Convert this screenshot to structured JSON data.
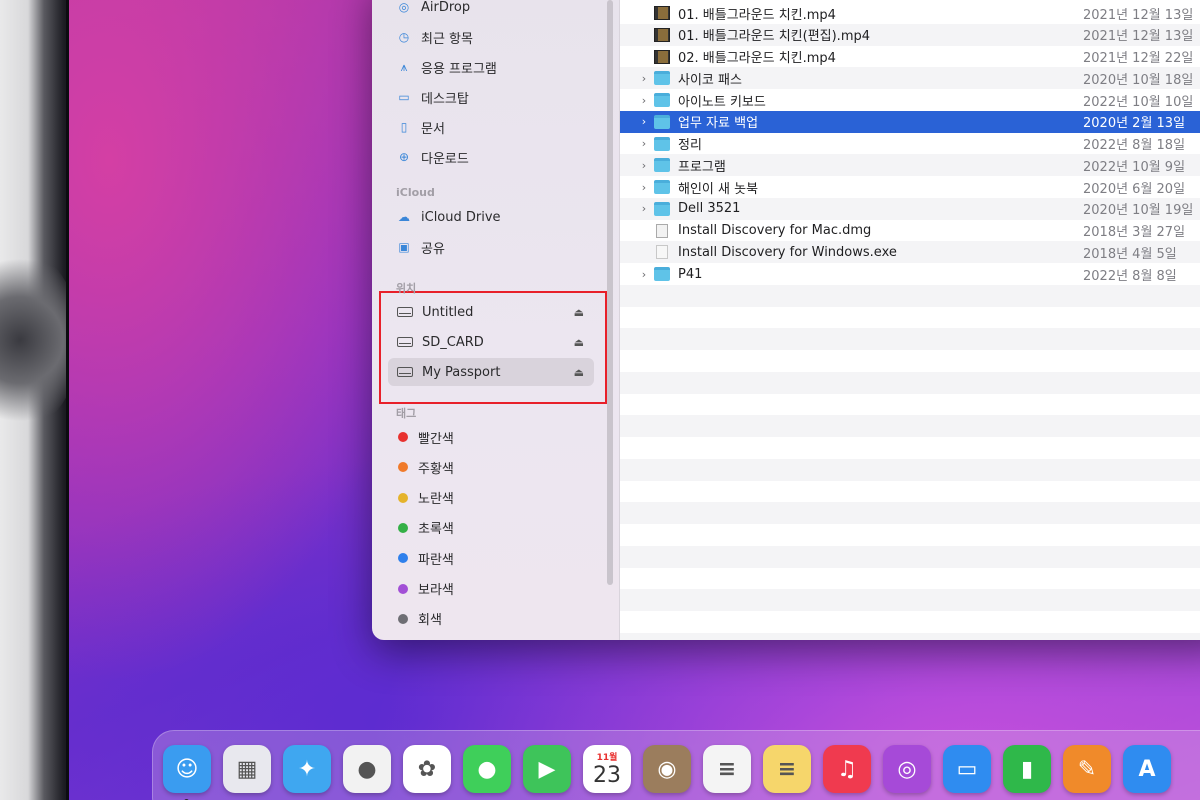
{
  "sidebar": {
    "favorites": [
      {
        "label": "AirDrop",
        "icon": "airdrop-icon"
      },
      {
        "label": "최근 항목",
        "icon": "clock-icon"
      },
      {
        "label": "응용 프로그램",
        "icon": "applications-icon"
      },
      {
        "label": "데스크탑",
        "icon": "desktop-icon"
      },
      {
        "label": "문서",
        "icon": "document-icon"
      },
      {
        "label": "다운로드",
        "icon": "download-icon"
      }
    ],
    "icloud_header": "iCloud",
    "icloud": [
      {
        "label": "iCloud Drive",
        "icon": "cloud-icon"
      },
      {
        "label": "공유",
        "icon": "shared-folder-icon"
      }
    ],
    "locations_header": "위치",
    "locations": [
      {
        "label": "Untitled",
        "icon": "drive-icon",
        "selected": false
      },
      {
        "label": "SD_CARD",
        "icon": "drive-icon",
        "selected": false
      },
      {
        "label": "My Passport",
        "icon": "drive-icon",
        "selected": true
      }
    ],
    "eject_glyph": "⏏",
    "tags_header": "태그",
    "tags": [
      {
        "label": "빨간색",
        "color": "#e8312f"
      },
      {
        "label": "주황색",
        "color": "#f07a2a"
      },
      {
        "label": "노란색",
        "color": "#e5b32b"
      },
      {
        "label": "초록색",
        "color": "#34b046"
      },
      {
        "label": "파란색",
        "color": "#2f80ec"
      },
      {
        "label": "보라색",
        "color": "#a24fd6"
      },
      {
        "label": "회색",
        "color": "#6e6e74"
      }
    ]
  },
  "files": [
    {
      "name": "01. 배틀그라운드 치킨.mp4",
      "date": "2021년 12월 13일",
      "kind": "video",
      "expandable": false,
      "selected": false
    },
    {
      "name": "01. 배틀그라운드 치킨(편집).mp4",
      "date": "2021년 12월 13일",
      "kind": "video",
      "expandable": false,
      "selected": false
    },
    {
      "name": "02. 배틀그라운드 치킨.mp4",
      "date": "2021년 12월 22일",
      "kind": "video",
      "expandable": false,
      "selected": false
    },
    {
      "name": "사이코 패스",
      "date": "2020년 10월 18일",
      "kind": "folder",
      "expandable": true,
      "selected": false
    },
    {
      "name": "아이노트 키보드",
      "date": "2022년 10월 10일",
      "kind": "folder",
      "expandable": true,
      "selected": false
    },
    {
      "name": "업무 자료 백업",
      "date": "2020년 2월 13일",
      "kind": "folder",
      "expandable": true,
      "selected": true
    },
    {
      "name": "정리",
      "date": "2022년 8월 18일",
      "kind": "folder",
      "expandable": true,
      "selected": false
    },
    {
      "name": "프로그램",
      "date": "2022년 10월 9일",
      "kind": "folder",
      "expandable": true,
      "selected": false
    },
    {
      "name": "해인이 새 놋북",
      "date": "2020년 6월 20일",
      "kind": "folder",
      "expandable": true,
      "selected": false
    },
    {
      "name": "Dell 3521",
      "date": "2020년 10월 19일",
      "kind": "folder",
      "expandable": true,
      "selected": false
    },
    {
      "name": "Install Discovery for Mac.dmg",
      "date": "2018년 3월 27일",
      "kind": "dmg",
      "expandable": false,
      "selected": false
    },
    {
      "name": "Install Discovery for Windows.exe",
      "date": "2018년 4월 5일",
      "kind": "exe",
      "expandable": false,
      "selected": false
    },
    {
      "name": "P41",
      "date": "2022년 8월 8일",
      "kind": "folder",
      "expandable": true,
      "selected": false
    }
  ],
  "expand_glyph": "›",
  "dock": [
    {
      "name": "finder",
      "glyph": "☺",
      "bg": "#3a9cf0"
    },
    {
      "name": "launchpad",
      "glyph": "▦",
      "bg": "#e8e8ee"
    },
    {
      "name": "safari",
      "glyph": "✦",
      "bg": "#3fa7f0"
    },
    {
      "name": "chrome",
      "glyph": "●",
      "bg": "#f2f2f2"
    },
    {
      "name": "photos",
      "glyph": "✿",
      "bg": "#ffffff"
    },
    {
      "name": "messages",
      "glyph": "●",
      "bg": "#3fcf5a"
    },
    {
      "name": "facetime",
      "glyph": "▶",
      "bg": "#3ec45a"
    },
    {
      "name": "calendar",
      "glyph": "23",
      "bg": "#ffffff",
      "month": "11월"
    },
    {
      "name": "contacts",
      "glyph": "◉",
      "bg": "#9b7d5d"
    },
    {
      "name": "reminders",
      "glyph": "≡",
      "bg": "#f4f4f4"
    },
    {
      "name": "notes",
      "glyph": "≡",
      "bg": "#f6d66b"
    },
    {
      "name": "music",
      "glyph": "♫",
      "bg": "#f03a4f"
    },
    {
      "name": "podcasts",
      "glyph": "◎",
      "bg": "#a64ad8"
    },
    {
      "name": "keynote",
      "glyph": "▭",
      "bg": "#2f8cf0"
    },
    {
      "name": "numbers",
      "glyph": "▮",
      "bg": "#2fb84a"
    },
    {
      "name": "pages",
      "glyph": "✎",
      "bg": "#f08a2a"
    },
    {
      "name": "app-store",
      "glyph": "A",
      "bg": "#2f8cf0"
    }
  ]
}
